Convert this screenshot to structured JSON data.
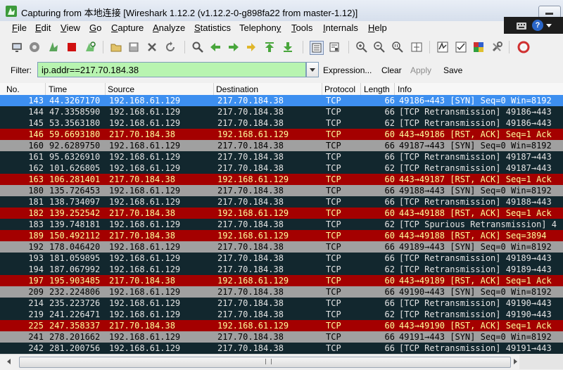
{
  "window": {
    "title": "Capturing from 本地连接   [Wireshark 1.12.2  (v1.12.2-0-g898fa22 from master-1.12)]"
  },
  "menu": [
    "File",
    "Edit",
    "View",
    "Go",
    "Capture",
    "Analyze",
    "Statistics",
    "Telephony",
    "Tools",
    "Internals",
    "Help"
  ],
  "menu_underline": [
    "F",
    "E",
    "V",
    "G",
    "C",
    "A",
    "S",
    "y",
    "T",
    "I",
    "H"
  ],
  "toolbar_icons": [
    "interfaces-icon",
    "options-icon",
    "start-capture-icon",
    "stop-capture-icon",
    "restart-capture-icon",
    "open-file-icon",
    "save-file-icon",
    "close-file-icon",
    "reload-icon",
    "find-packet-icon",
    "go-back-icon",
    "go-forward-icon",
    "go-to-packet-icon",
    "go-first-icon",
    "go-last-icon",
    "colorize-icon",
    "auto-scroll-icon",
    "zoom-in-icon",
    "zoom-out-icon",
    "normal-size-icon",
    "resize-columns-icon",
    "capture-filters-icon",
    "display-filters-icon",
    "coloring-rules-icon",
    "preferences-icon",
    "help-icon"
  ],
  "filter": {
    "label": "Filter:",
    "value": "ip.addr==217.70.184.38",
    "expression": "Expression...",
    "clear": "Clear",
    "apply": "Apply",
    "save": "Save"
  },
  "columns": [
    "No.",
    "Time",
    "Source",
    "Destination",
    "Protocol",
    "Length",
    "Info"
  ],
  "colors": {
    "selected_bg": "#3d8ff0",
    "selected_fg": "#ffffff",
    "teal_bg": "#12272e",
    "teal_fg": "#e3e3e3",
    "red_bg": "#a40000",
    "red_fg": "#fffc9c",
    "gray_bg": "#a0a0a0",
    "gray_fg": "#000000"
  },
  "packets": [
    {
      "no": "143",
      "time": "44.3267170",
      "src": "192.168.61.129",
      "dst": "217.70.184.38",
      "proto": "TCP",
      "len": "66",
      "info": "49186→443 [SYN] Seq=0 Win=8192",
      "style": "selected"
    },
    {
      "no": "144",
      "time": "47.3358590",
      "src": "192.168.61.129",
      "dst": "217.70.184.38",
      "proto": "TCP",
      "len": "66",
      "info": "[TCP Retransmission] 49186→443",
      "style": "teal"
    },
    {
      "no": "145",
      "time": "53.3563180",
      "src": "192.168.61.129",
      "dst": "217.70.184.38",
      "proto": "TCP",
      "len": "62",
      "info": "[TCP Retransmission] 49186→443",
      "style": "teal"
    },
    {
      "no": "146",
      "time": "59.6693180",
      "src": "217.70.184.38",
      "dst": "192.168.61.129",
      "proto": "TCP",
      "len": "60",
      "info": "443→49186 [RST, ACK] Seq=1 Ack",
      "style": "red"
    },
    {
      "no": "160",
      "time": "92.6289750",
      "src": "192.168.61.129",
      "dst": "217.70.184.38",
      "proto": "TCP",
      "len": "66",
      "info": "49187→443 [SYN] Seq=0 Win=8192",
      "style": "gray"
    },
    {
      "no": "161",
      "time": "95.6326910",
      "src": "192.168.61.129",
      "dst": "217.70.184.38",
      "proto": "TCP",
      "len": "66",
      "info": "[TCP Retransmission] 49187→443",
      "style": "teal"
    },
    {
      "no": "162",
      "time": "101.626805",
      "src": "192.168.61.129",
      "dst": "217.70.184.38",
      "proto": "TCP",
      "len": "62",
      "info": "[TCP Retransmission] 49187→443",
      "style": "teal"
    },
    {
      "no": "163",
      "time": "106.281401",
      "src": "217.70.184.38",
      "dst": "192.168.61.129",
      "proto": "TCP",
      "len": "60",
      "info": "443→49187 [RST, ACK] Seq=1 Ack",
      "style": "red"
    },
    {
      "no": "180",
      "time": "135.726453",
      "src": "192.168.61.129",
      "dst": "217.70.184.38",
      "proto": "TCP",
      "len": "66",
      "info": "49188→443 [SYN] Seq=0 Win=8192",
      "style": "gray"
    },
    {
      "no": "181",
      "time": "138.734097",
      "src": "192.168.61.129",
      "dst": "217.70.184.38",
      "proto": "TCP",
      "len": "66",
      "info": "[TCP Retransmission] 49188→443",
      "style": "teal"
    },
    {
      "no": "182",
      "time": "139.252542",
      "src": "217.70.184.38",
      "dst": "192.168.61.129",
      "proto": "TCP",
      "len": "60",
      "info": "443→49188 [RST, ACK] Seq=1 Ack",
      "style": "red"
    },
    {
      "no": "183",
      "time": "139.748181",
      "src": "192.168.61.129",
      "dst": "217.70.184.38",
      "proto": "TCP",
      "len": "62",
      "info": "[TCP Spurious Retransmission] 4",
      "style": "teal"
    },
    {
      "no": "189",
      "time": "150.492112",
      "src": "217.70.184.38",
      "dst": "192.168.61.129",
      "proto": "TCP",
      "len": "60",
      "info": "443→49188 [RST, ACK] Seq=3894",
      "style": "red"
    },
    {
      "no": "192",
      "time": "178.046420",
      "src": "192.168.61.129",
      "dst": "217.70.184.38",
      "proto": "TCP",
      "len": "66",
      "info": "49189→443 [SYN] Seq=0 Win=8192",
      "style": "gray"
    },
    {
      "no": "193",
      "time": "181.059895",
      "src": "192.168.61.129",
      "dst": "217.70.184.38",
      "proto": "TCP",
      "len": "66",
      "info": "[TCP Retransmission] 49189→443",
      "style": "teal"
    },
    {
      "no": "194",
      "time": "187.067992",
      "src": "192.168.61.129",
      "dst": "217.70.184.38",
      "proto": "TCP",
      "len": "62",
      "info": "[TCP Retransmission] 49189→443",
      "style": "teal"
    },
    {
      "no": "197",
      "time": "195.903485",
      "src": "217.70.184.38",
      "dst": "192.168.61.129",
      "proto": "TCP",
      "len": "60",
      "info": "443→49189 [RST, ACK] Seq=1 Ack",
      "style": "red"
    },
    {
      "no": "209",
      "time": "232.224806",
      "src": "192.168.61.129",
      "dst": "217.70.184.38",
      "proto": "TCP",
      "len": "66",
      "info": "49190→443 [SYN] Seq=0 Win=8192",
      "style": "gray"
    },
    {
      "no": "214",
      "time": "235.223726",
      "src": "192.168.61.129",
      "dst": "217.70.184.38",
      "proto": "TCP",
      "len": "66",
      "info": "[TCP Retransmission] 49190→443",
      "style": "teal"
    },
    {
      "no": "219",
      "time": "241.226471",
      "src": "192.168.61.129",
      "dst": "217.70.184.38",
      "proto": "TCP",
      "len": "62",
      "info": "[TCP Retransmission] 49190→443",
      "style": "teal"
    },
    {
      "no": "225",
      "time": "247.358337",
      "src": "217.70.184.38",
      "dst": "192.168.61.129",
      "proto": "TCP",
      "len": "60",
      "info": "443→49190 [RST, ACK] Seq=1 Ack",
      "style": "red"
    },
    {
      "no": "241",
      "time": "278.201662",
      "src": "192.168.61.129",
      "dst": "217.70.184.38",
      "proto": "TCP",
      "len": "66",
      "info": "49191→443 [SYN] Seq=0 Win=8192",
      "style": "gray"
    },
    {
      "no": "242",
      "time": "281.200756",
      "src": "192.168.61.129",
      "dst": "217.70.184.38",
      "proto": "TCP",
      "len": "66",
      "info": "[TCP Retransmission] 49191→443",
      "style": "teal"
    }
  ],
  "tray": {
    "help_glyph": "?"
  }
}
